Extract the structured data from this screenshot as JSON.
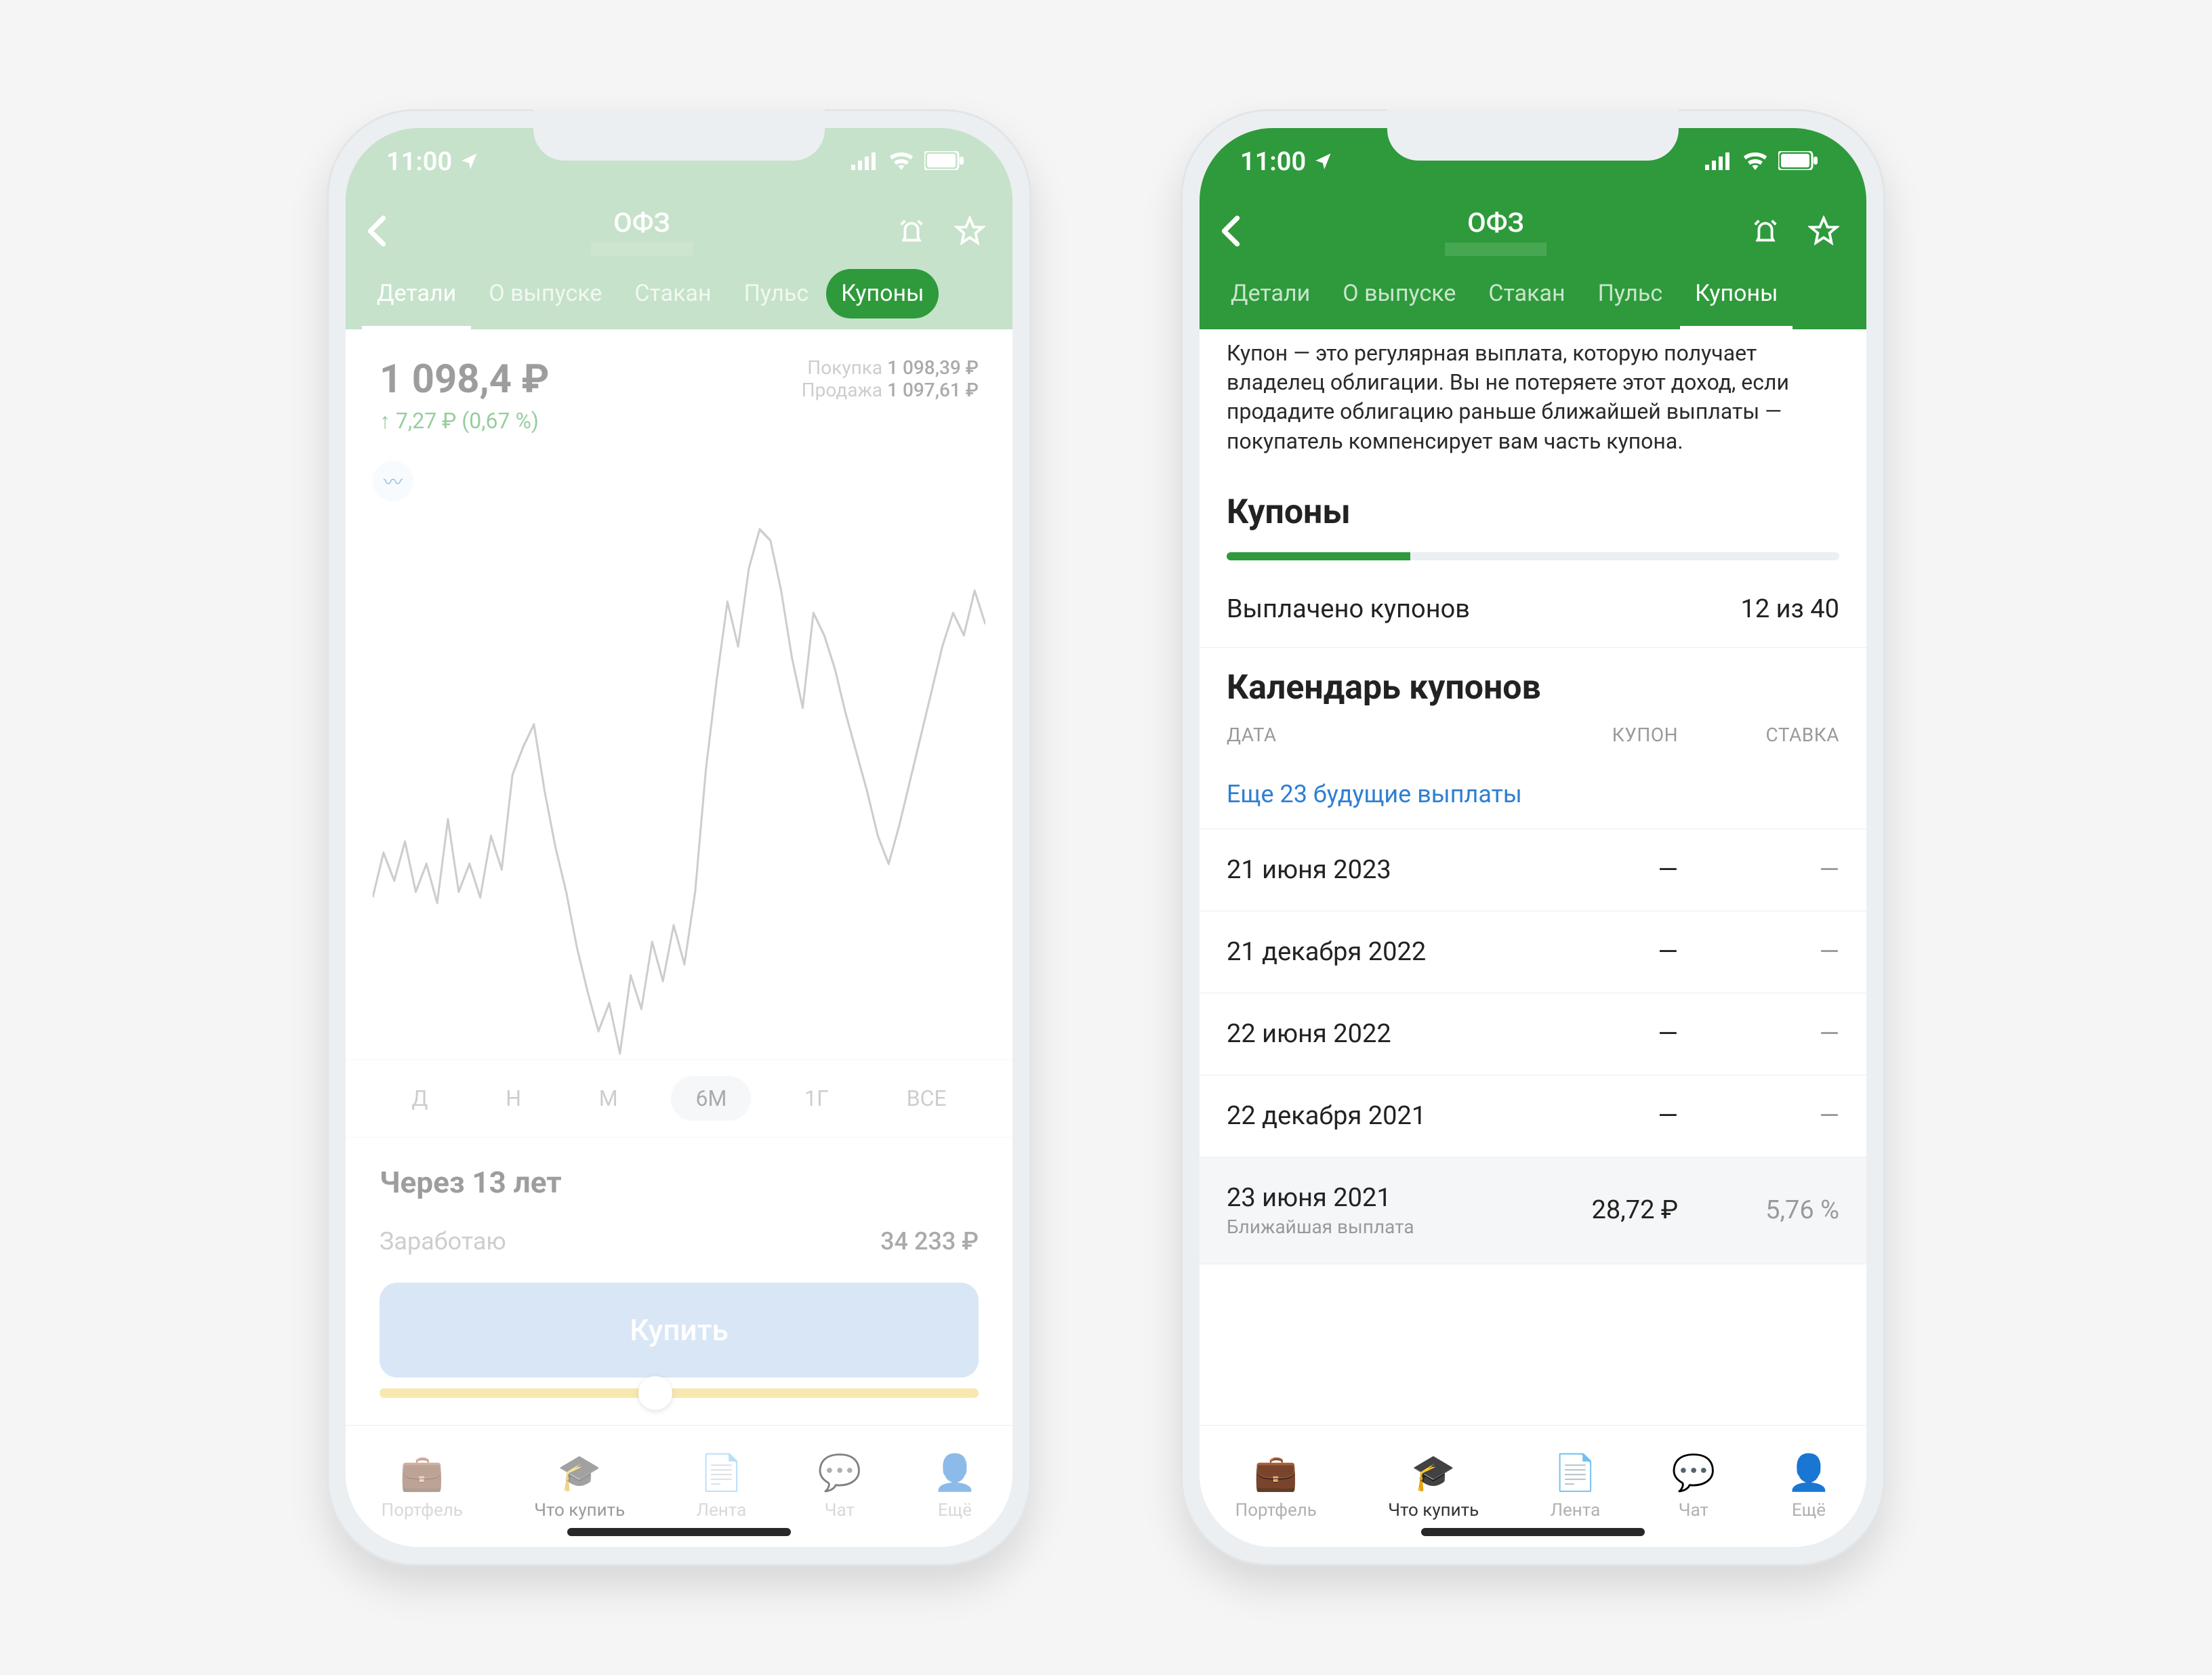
{
  "status_bar": {
    "time": "11:00"
  },
  "header": {
    "title": "ОФЗ"
  },
  "tabs": {
    "details": "Детали",
    "about": "О выпуске",
    "orderbook": "Стакан",
    "pulse": "Пульс",
    "coupons": "Купоны"
  },
  "left": {
    "price": "1 098,4 ₽",
    "delta": "7,27 ₽ (0,67 %)",
    "buy_label": "Покупка",
    "buy_price": "1 098,39 ₽",
    "sell_label": "Продажа",
    "sell_price": "1 097,61 ₽",
    "periods": {
      "d": "Д",
      "w": "Н",
      "m": "М",
      "m6": "6М",
      "y1": "1Г",
      "all": "ВСЕ"
    },
    "earn_title": "Через 13 лет",
    "earn_label": "Заработаю",
    "earn_value": "34 233 ₽",
    "buy_button": "Купить"
  },
  "right": {
    "coupon_desc": "Купон — это регулярная выплата, которую получает владелец облигации. Вы не потеряете этот доход, если продадите облигацию раньше ближайшей выплаты — покупатель компенсирует вам часть купона.",
    "section_coupons": "Купоны",
    "paid_label": "Выплачено купонов",
    "paid_value": "12 из 40",
    "progress_pct": 30,
    "section_calendar": "Календарь купонов",
    "headers": {
      "date": "ДАТА",
      "coupon": "КУПОН",
      "rate": "СТАВКА"
    },
    "more_link": "Еще 23 будущие выплаты",
    "rows": [
      {
        "date": "21 июня 2023",
        "coupon": "—",
        "rate": "—"
      },
      {
        "date": "21 декабря 2022",
        "coupon": "—",
        "rate": "—"
      },
      {
        "date": "22 июня 2022",
        "coupon": "—",
        "rate": "—"
      },
      {
        "date": "22 декабря 2021",
        "coupon": "—",
        "rate": "—"
      },
      {
        "date": "23 июня 2021",
        "sub": "Ближайшая выплата",
        "coupon": "28,72 ₽",
        "rate": "5,76 %"
      }
    ]
  },
  "nav": {
    "portfolio": "Портфель",
    "whatbuy": "Что купить",
    "feed": "Лента",
    "chat": "Чат",
    "more": "Ещё"
  },
  "chart_data": {
    "type": "line",
    "title": "",
    "xlabel": "",
    "ylabel": "",
    "period": "6М",
    "ylim": [
      1020,
      1120
    ],
    "series": [
      {
        "name": "price",
        "values": [
          1049,
          1057,
          1052,
          1059,
          1050,
          1055,
          1048,
          1063,
          1050,
          1055,
          1049,
          1060,
          1054,
          1071,
          1076,
          1080,
          1068,
          1058,
          1050,
          1040,
          1032,
          1025,
          1030,
          1021,
          1035,
          1029,
          1041,
          1034,
          1044,
          1037,
          1050,
          1072,
          1088,
          1102,
          1094,
          1108,
          1115,
          1113,
          1104,
          1092,
          1083,
          1100,
          1096,
          1090,
          1082,
          1075,
          1068,
          1060,
          1055,
          1062,
          1070,
          1078,
          1086,
          1094,
          1100,
          1096,
          1104,
          1098
        ]
      }
    ]
  }
}
